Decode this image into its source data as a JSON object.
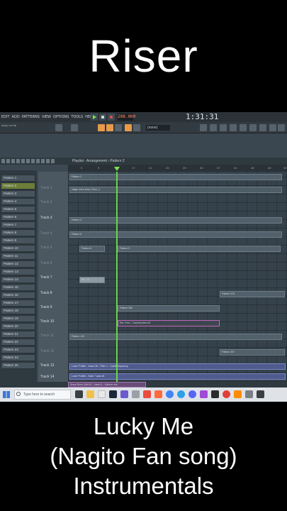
{
  "caption_top": "Riser",
  "caption_bottom": [
    "Lucky Me",
    "(Nagito Fan song)",
    "Instrumentals"
  ],
  "fl": {
    "menu": [
      "EDIT",
      "ADD",
      "PATTERNS",
      "VIEW",
      "OPTIONS",
      "TOOLS",
      "HELP"
    ],
    "bpm": "208.000",
    "time": "1:31:31",
    "pattern_select": "(none)",
    "file_name": "lucky me.flp",
    "accent": "#6ad54a"
  },
  "playlist": {
    "title": "Playlist - Arrangement › Pattern 2",
    "ruler": [
      "5",
      "9",
      "13",
      "17",
      "21",
      "25",
      "29",
      "33",
      "37",
      "41",
      "45",
      "49",
      "53"
    ],
    "patterns": [
      "Pattern 1",
      "Pattern 2",
      "Pattern 3",
      "Pattern 4",
      "Pattern 5",
      "Pattern 6",
      "Pattern 7",
      "Pattern 8",
      "Pattern 9",
      "Pattern 10",
      "Pattern 11",
      "Pattern 12",
      "Pattern 13",
      "Pattern 14",
      "Pattern 15",
      "Pattern 16",
      "Pattern 17",
      "Pattern 18",
      "Pattern 19",
      "Pattern 20",
      "Pattern 21",
      "Pattern 22",
      "Pattern 23",
      "Pattern 24",
      "Pattern 25"
    ],
    "selected_pattern": "Pattern 2",
    "tracks": [
      {
        "label": "Track 1",
        "dim": true
      },
      {
        "label": "Track 2",
        "dim": true
      },
      {
        "label": "Track 3",
        "dim": false
      },
      {
        "label": "Track 4",
        "dim": true
      },
      {
        "label": "Track 5",
        "dim": true
      },
      {
        "label": "Track 6",
        "dim": true
      },
      {
        "label": "Track 7",
        "dim": false
      },
      {
        "label": "Track 8",
        "dim": false
      },
      {
        "label": "Track 9",
        "dim": false
      },
      {
        "label": "Track 10",
        "dim": false
      },
      {
        "label": "Track 11",
        "dim": true
      },
      {
        "label": "Track 12",
        "dim": true
      },
      {
        "label": "Track 13",
        "dim": false
      },
      {
        "label": "Track 14",
        "dim": false
      },
      {
        "label": "Track 15",
        "dim": false
      }
    ],
    "clips": {
      "c1": "Pattern 2",
      "c2": "stage-more-lead_Piano_1",
      "c3": "Pattern 3",
      "c4": "Pattern 6",
      "c5": "Pattern 8",
      "c6": "Pattern 9",
      "c7": "Pa.. 12",
      "c8": "Pattern 378",
      "c9": "Pattern 380",
      "c10": "Ear. Fres - Channel pitch #1",
      "c11": "Pattern 129",
      "c12": "Pattern 397",
      "c13": "Lowe Profiler - Insert 36 - Filter 1 - Cutoff frequency",
      "c14": "Lowe Profiler - Note 7 auto #4",
      "c15": "Snow River Chill #2 - Insert 6 - Volume mid"
    }
  },
  "taskbar": {
    "search_placeholder": "Type here to search"
  }
}
